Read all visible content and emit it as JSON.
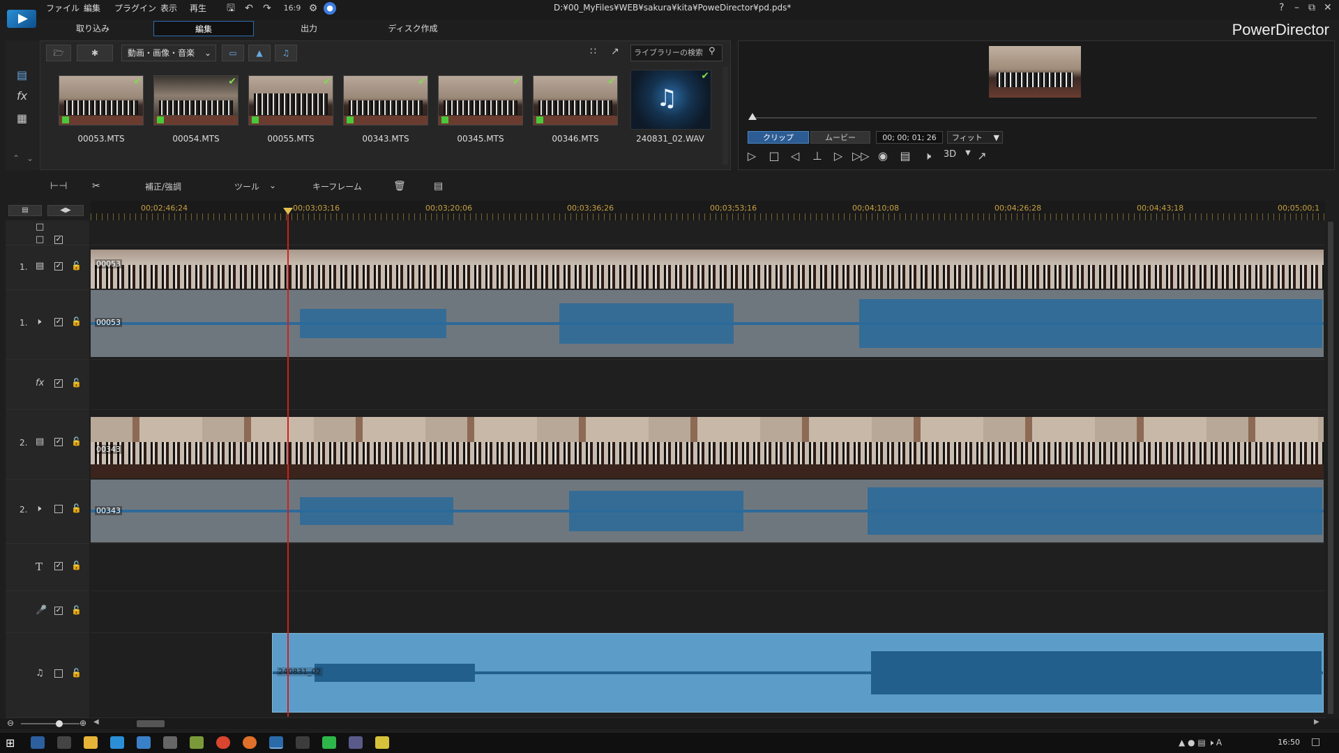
{
  "window": {
    "file_path": "D:¥00_MyFiles¥WEB¥sakura¥kita¥PoweDirector¥pd.pds*",
    "brand": "PowerDirector",
    "help": "?",
    "min": "–",
    "restore": "⧉",
    "close": "✕"
  },
  "menu": [
    "ファイル",
    "編集",
    "プラグイン",
    "表示",
    "再生"
  ],
  "mode_tabs": [
    "取り込み",
    "編集",
    "出力",
    "ディスク作成"
  ],
  "active_mode_tab": "編集",
  "library": {
    "filter_label": "動画・画像・音楽",
    "search_placeholder": "ライブラリーの検索",
    "clips": [
      {
        "name": "00053.MTS"
      },
      {
        "name": "00054.MTS"
      },
      {
        "name": "00055.MTS"
      },
      {
        "name": "00343.MTS"
      },
      {
        "name": "00345.MTS"
      },
      {
        "name": "00346.MTS"
      },
      {
        "name": "240831_02.WAV"
      }
    ]
  },
  "preview": {
    "clip_tab": "クリップ",
    "movie_tab": "ムービー",
    "timecode": "00; 00; 01; 26",
    "fit_label": "フィット",
    "mode_3d": "3D"
  },
  "timeline_toolbar": {
    "fix_enhance": "補正/強調",
    "tools": "ツール",
    "keyframe": "キーフレーム"
  },
  "ruler_ticks": [
    "00;02;46;24",
    "00;03;03;16",
    "00;03;20;06",
    "00;03;36;26",
    "00;03;53;16",
    "00;04;10;08",
    "00;04;26;28",
    "00;04;43;18",
    "00;05;00;1"
  ],
  "tracks": {
    "video1_num": "1.",
    "audio1_num": "1.",
    "video2_num": "2.",
    "audio2_num": "2.",
    "fx_label": "fx",
    "title_icon": "T",
    "clip_video1": "00053",
    "clip_audio1": "00053",
    "clip_video2": "00343",
    "clip_audio2": "00343",
    "clip_music": "240831_02"
  },
  "clock": "16:50",
  "colors": {
    "accent": "#2f6fb3",
    "playhead": "#d02020",
    "waveform": "#2c6a9a",
    "music_clip": "#5b9cc9"
  }
}
